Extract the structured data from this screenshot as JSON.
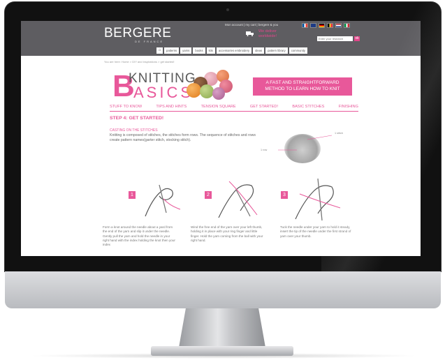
{
  "topbar": {
    "logo": "BERGERE",
    "logo_sub": "DE FRANCE",
    "links": "Mon account | my cart | bergere & you",
    "deliver": "We deliver worldwide!",
    "search_placeholder": "Enter your research",
    "search_button": "ok"
  },
  "nav": {
    "home_icon": "home-icon",
    "items": [
      "patterns",
      "yarns",
      "books",
      "kits",
      "accessories embroidery",
      "ideas",
      "pattern library",
      "community"
    ]
  },
  "breadcrumb": "You are here: Home > DIY and inspirations > get started!",
  "header": {
    "big_letter": "B",
    "title1": "KNITTING",
    "title2": "ASICS",
    "tagline": "A FAST AND STRAIGHTFORWARD METHOD TO LEARN HOW TO KNIT"
  },
  "tabs": [
    "STUFF TO KNOW",
    "TIPS AND HINTS",
    "TENSION SQUARE",
    "GET STARTED!",
    "BASIC STITCHES",
    "FINISHING"
  ],
  "content": {
    "step_title": "STEP 4: GET STARTED!",
    "sub_title": "CASTING ON THE STITCHES",
    "paragraph": "Knitting is composed of stitches, the stitches form rows. The sequence of stitches and rows create pattern names(garter stitch, stocking stitch).",
    "callout_stitch": "1 stitch",
    "callout_row": "1 row",
    "steps": [
      {
        "num": "1",
        "text": "Form a knot around the needle about a yard from the end of the yarn and slip it under the needle. Gently pull the yarn and hold the needle in your right hand with the index holding the knot then your index"
      },
      {
        "num": "2",
        "text": "Wind the free end of the yarn over your left thumb, holding it in place with your ring finger and little finger. Hold the yarn coming from the ball with your right hand."
      },
      {
        "num": "3",
        "text": "Tuck the needle under your yarn to hold it steady, insert the tip of the needle under the first strand of yarn over your thumb."
      }
    ]
  },
  "colors": {
    "accent": "#e8589a",
    "topbar": "#5e5d61",
    "bezel": "#111111"
  }
}
